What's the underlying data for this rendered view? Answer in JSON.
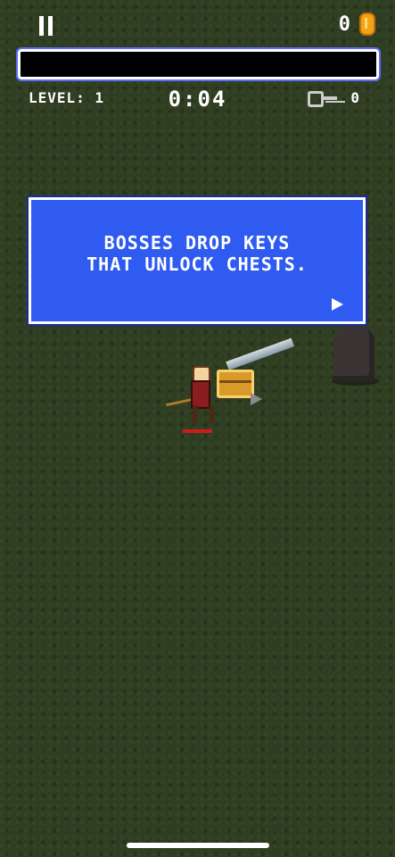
{
  "hud": {
    "coins": "0",
    "level_label": "LEVEL: 1",
    "timer": "0:04",
    "keys": "0",
    "xp_progress": 0.0
  },
  "dialog": {
    "line1": "BOSSES DROP KEYS",
    "line2": "THAT UNLOCK CHESTS."
  },
  "icons": {
    "pause": "pause-icon",
    "coin": "coin-icon",
    "key": "key-icon",
    "next": "next-arrow-icon"
  },
  "colors": {
    "background": "#2f3d22",
    "dialog": "#2f5bf0",
    "xp_border": "#5b6cff",
    "hp": "#d21a1a",
    "coin": "#f4a216"
  }
}
